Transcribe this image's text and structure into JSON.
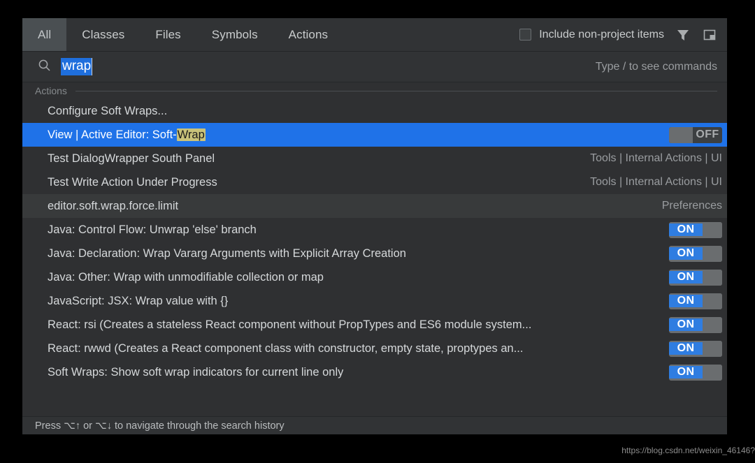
{
  "header": {
    "tabs": [
      {
        "label": "All",
        "active": true
      },
      {
        "label": "Classes",
        "active": false
      },
      {
        "label": "Files",
        "active": false
      },
      {
        "label": "Symbols",
        "active": false
      },
      {
        "label": "Actions",
        "active": false
      }
    ],
    "include_non_project": {
      "label": "Include non-project items",
      "checked": false
    },
    "filter_icon": "filter-funnel-icon",
    "preview_icon": "preview-panel-icon"
  },
  "search": {
    "icon": "search-icon",
    "value": "wrap",
    "selected": true,
    "hint": "Type / to see commands"
  },
  "group": {
    "label": "Actions"
  },
  "results": [
    {
      "title": "Configure Soft Wraps...",
      "match": "",
      "path": "",
      "toggle": "",
      "selected": false,
      "alt": false
    },
    {
      "title": "View | Active Editor: Soft-",
      "match": "Wrap",
      "path": "",
      "toggle": "OFF",
      "selected": true,
      "alt": false
    },
    {
      "title": "Test DialogWrapper South Panel",
      "match": "",
      "path": "Tools | Internal Actions | UI",
      "toggle": "",
      "selected": false,
      "alt": false
    },
    {
      "title": "Test Write Action Under Progress",
      "match": "",
      "path": "Tools | Internal Actions | UI",
      "toggle": "",
      "selected": false,
      "alt": false
    },
    {
      "title": "editor.soft.wrap.force.limit",
      "match": "",
      "path": "Preferences",
      "toggle": "",
      "selected": false,
      "alt": true
    },
    {
      "title": "Java: Control Flow: Unwrap 'else' branch",
      "match": "",
      "path": "",
      "toggle": "ON",
      "selected": false,
      "alt": false
    },
    {
      "title": "Java: Declaration: Wrap Vararg Arguments with Explicit Array Creation",
      "match": "",
      "path": "",
      "toggle": "ON",
      "selected": false,
      "alt": false
    },
    {
      "title": "Java: Other: Wrap with unmodifiable collection or map",
      "match": "",
      "path": "",
      "toggle": "ON",
      "selected": false,
      "alt": false
    },
    {
      "title": "JavaScript: JSX: Wrap value with {}",
      "match": "",
      "path": "",
      "toggle": "ON",
      "selected": false,
      "alt": false
    },
    {
      "title": "React: rsi (Creates a stateless React component without PropTypes and ES6 module system...",
      "match": "",
      "path": "",
      "toggle": "ON",
      "selected": false,
      "alt": false
    },
    {
      "title": "React: rwwd (Creates a React component class with constructor, empty state, proptypes an...",
      "match": "",
      "path": "",
      "toggle": "ON",
      "selected": false,
      "alt": false
    },
    {
      "title": "Soft Wraps: Show soft wrap indicators for current line only",
      "match": "",
      "path": "",
      "toggle": "ON",
      "selected": false,
      "alt": false
    }
  ],
  "footer": {
    "text": "Press ⌥↑ or ⌥↓ to navigate through the search history"
  },
  "watermark": {
    "text": "https://blog.csdn.net/weixin_46146?"
  },
  "colors": {
    "dialog_bg": "#2f3032",
    "header_bg": "#313335",
    "tab_active_bg": "#4a4f52",
    "row_alt_bg": "#383a3b",
    "selection_blue": "#1f72e8",
    "toggle_on_blue": "#2f7de1",
    "match_highlight": "#c9c27a",
    "text_primary": "#d5d8da",
    "text_muted": "#9a9da0"
  }
}
